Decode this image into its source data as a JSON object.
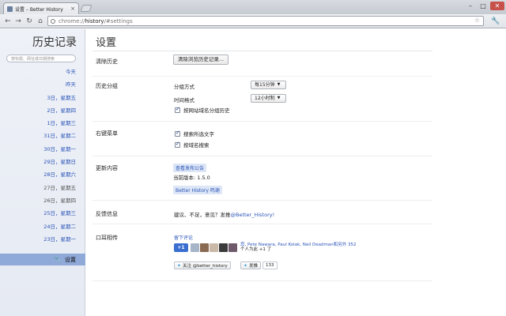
{
  "browser": {
    "tab_title": "设置 – Better History",
    "tab_close": "×",
    "url_prefix": "chrome://",
    "url_host": "history",
    "url_path": "/#settings",
    "icons": {
      "back": "←",
      "forward": "→",
      "reload": "↻",
      "home": "⌂",
      "star": "☆",
      "wrench": "🔧",
      "minimize": "–",
      "maximize": "□",
      "close": "✕"
    }
  },
  "sidebar": {
    "title": "历史记录",
    "search_placeholder": "按标题、网址或日期搜索",
    "days": [
      {
        "label": "今天"
      },
      {
        "label": "昨天"
      },
      {
        "label": "3日，星期五"
      },
      {
        "label": "2日，星期四"
      },
      {
        "label": "1日，星期三"
      },
      {
        "label": "31日，星期二"
      },
      {
        "label": "30日，星期一"
      },
      {
        "label": "29日，星期日"
      },
      {
        "label": "28日，星期六"
      },
      {
        "label": "27日，星期五"
      },
      {
        "label": "26日，星期四"
      },
      {
        "label": "25日，星期三"
      },
      {
        "label": "24日，星期二"
      },
      {
        "label": "23日，星期一"
      }
    ],
    "settings_label": "设置"
  },
  "main": {
    "title": "设置",
    "clear_history": {
      "label": "清除历史",
      "button": "清除浏览历史记录..."
    },
    "grouping": {
      "label": "历史分组",
      "time_group_label": "分组方式",
      "time_group_value": "每15分钟",
      "time_format_label": "时间格式",
      "time_format_value": "12小时制",
      "domain_group_label": "按网站域名分组历史"
    },
    "context_menu": {
      "label": "右键菜单",
      "search_selected": "搜索所选文字",
      "search_domain": "按域名搜索"
    },
    "updates": {
      "label": "更新内容",
      "release_notes": "查看发布公告",
      "version_text": "当前版本: 1.5.0",
      "credits": "Better History 鸣谢"
    },
    "feedback": {
      "label": "反馈信息",
      "text": "建议、不足，意见？发推",
      "handle": "@Better_History!"
    },
    "social": {
      "label": "口耳相传",
      "review_link": "留下评论",
      "plus_one": "+1",
      "plus_text_line1": "您, Pete Nawara, Paul Kolak, Neil Deadman和另外 352",
      "plus_text_line2": "个人为此 +1 了",
      "follow_button": "关注 @better_history",
      "tweet_button": "发推",
      "tweet_count": "133"
    }
  },
  "colors": {
    "link": "#2b55b8",
    "sidebar_selected": "#8fa9d8",
    "gplus": "#3a6fd0"
  }
}
